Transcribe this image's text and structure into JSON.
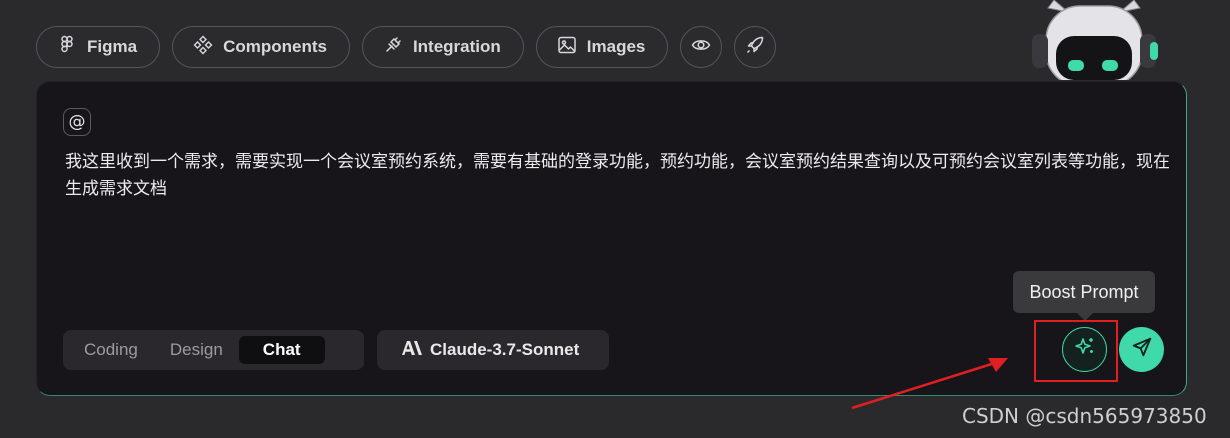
{
  "toolbar": {
    "figma": {
      "label": "Figma",
      "icon": "figma-icon"
    },
    "components": {
      "label": "Components",
      "icon": "components-icon"
    },
    "integration": {
      "label": "Integration",
      "icon": "plug-icon"
    },
    "images": {
      "label": "Images",
      "icon": "image-icon"
    },
    "preview_icon": "eye-icon",
    "deploy_icon": "rocket-icon"
  },
  "input": {
    "mention_symbol": "@",
    "text": "我这里收到一个需求，需要实现一个会议室预约系统，需要有基础的登录功能，预约功能，会议室预约结果查询以及可预约会议室列表等功能，现在生成需求文档"
  },
  "modes": {
    "items": [
      {
        "label": "Coding"
      },
      {
        "label": "Design"
      },
      {
        "label": "Chat"
      }
    ],
    "selected": "Chat"
  },
  "model": {
    "label": "Claude-3.7-Sonnet",
    "icon": "anthropic-icon"
  },
  "boost": {
    "tooltip": "Boost Prompt",
    "icon": "sparkles-icon"
  },
  "send": {
    "icon": "send-icon"
  },
  "watermark": "CSDN @csdn565973850",
  "colors": {
    "accent": "#3fd9aa",
    "annotation": "#e02020",
    "panel_bg": "#17151a",
    "page_bg": "#2a2a2d"
  }
}
